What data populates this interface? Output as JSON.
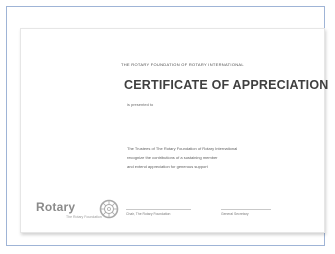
{
  "certificate": {
    "header": "THE ROTARY FOUNDATION OF ROTARY INTERNATIONAL",
    "title": "CERTIFICATE OF APPRECIATION",
    "presented_to": "is presented to",
    "body_lines": [
      "The Trustees of The Rotary Foundation of Rotary International",
      "recognize the contributions of a sustaining member",
      "and extend appreciation for generous support"
    ],
    "signature_left": "Chair, The Rotary Foundation",
    "signature_right": "General Secretary"
  },
  "logo": {
    "name": "Rotary",
    "sub": "The Rotary Foundation",
    "icon": "rotary-wheel-icon"
  },
  "colors": {
    "frame_border": "#9fb4d6",
    "title_text": "#3f3f3f",
    "logo_gray": "#8a8a8a"
  }
}
